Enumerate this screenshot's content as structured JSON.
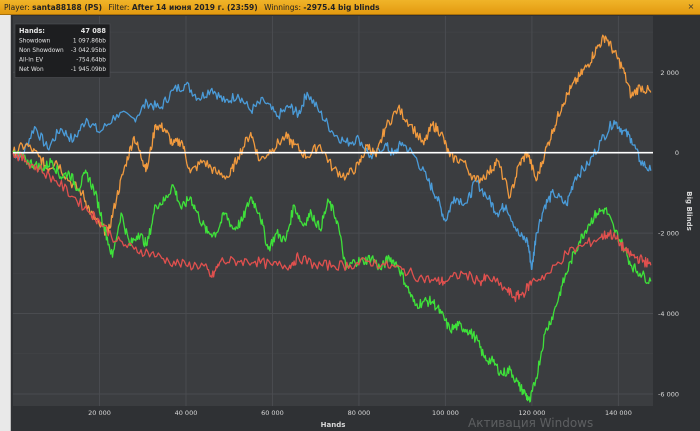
{
  "header": {
    "player_label": "Player:",
    "player_value": "santa88188 (PS)",
    "filter_label": "Filter:",
    "filter_value": "After 14 июня 2019 г. (23:59)",
    "winnings_label": "Winnings:",
    "winnings_value": "-2975.4 big blinds",
    "close_glyph": "×"
  },
  "stats": {
    "rows": [
      {
        "label": "Hands:",
        "value": "47 088"
      },
      {
        "label": "Showdown",
        "value": "1 097.86bb"
      },
      {
        "label": "Non Showdown",
        "value": "-3 042.95bb"
      },
      {
        "label": "All-In EV",
        "value": "-754.64bb"
      },
      {
        "label": "Net Won",
        "value": "-1 945.09bb"
      }
    ]
  },
  "watermark": "Активация Windows",
  "chart_data": {
    "type": "line",
    "xlabel": "Hands",
    "ylabel": "Big Blinds",
    "xlim": [
      0,
      148000
    ],
    "ylim": [
      -6300,
      3400
    ],
    "x_ticks": [
      20000,
      40000,
      60000,
      80000,
      100000,
      120000,
      140000
    ],
    "x_tick_labels": [
      "20 000",
      "40 000",
      "60 000",
      "80 000",
      "100 000",
      "120 000",
      "140 000"
    ],
    "y_ticks": [
      2000,
      0,
      -2000,
      -4000,
      -6000
    ],
    "y_tick_labels": [
      "2 000",
      "0",
      "-2 000",
      "-4 000",
      "-6 000"
    ],
    "y_axis_side": "right",
    "grid": true,
    "zero_line": true,
    "colors": {
      "blue": "#4a9bd8",
      "orange": "#f19a3e",
      "green": "#3ee03a",
      "red": "#e0504e",
      "zero": "#ffffff",
      "background": "#3b3d40",
      "grid": "#4a4c50",
      "text": "#d8d8d8"
    },
    "series": [
      {
        "color": "blue",
        "points": [
          [
            0,
            0
          ],
          [
            2000,
            -100
          ],
          [
            5000,
            650
          ],
          [
            8000,
            100
          ],
          [
            11000,
            600
          ],
          [
            14000,
            300
          ],
          [
            17000,
            850
          ],
          [
            20000,
            500
          ],
          [
            24000,
            950
          ],
          [
            28000,
            850
          ],
          [
            31000,
            1250
          ],
          [
            34000,
            1100
          ],
          [
            37000,
            1550
          ],
          [
            40000,
            1700
          ],
          [
            43000,
            1350
          ],
          [
            46000,
            1600
          ],
          [
            49000,
            1250
          ],
          [
            52000,
            1450
          ],
          [
            55000,
            1050
          ],
          [
            58000,
            1300
          ],
          [
            61000,
            900
          ],
          [
            64000,
            1150
          ],
          [
            66000,
            950
          ],
          [
            68000,
            1500
          ],
          [
            71000,
            1000
          ],
          [
            74000,
            500
          ],
          [
            77000,
            250
          ],
          [
            80000,
            350
          ],
          [
            83000,
            -150
          ],
          [
            86000,
            200
          ],
          [
            88000,
            -50
          ],
          [
            90000,
            250
          ],
          [
            93000,
            -100
          ],
          [
            96000,
            -700
          ],
          [
            98000,
            -1100
          ],
          [
            100000,
            -1700
          ],
          [
            102000,
            -1100
          ],
          [
            105000,
            -1250
          ],
          [
            107000,
            -700
          ],
          [
            110000,
            -1150
          ],
          [
            112000,
            -1500
          ],
          [
            114000,
            -1300
          ],
          [
            117000,
            -2050
          ],
          [
            119000,
            -2200
          ],
          [
            120000,
            -2900
          ],
          [
            121000,
            -2000
          ],
          [
            123000,
            -1300
          ],
          [
            125000,
            -1000
          ],
          [
            128000,
            -1300
          ],
          [
            130000,
            -600
          ],
          [
            133000,
            -300
          ],
          [
            136000,
            300
          ],
          [
            139000,
            800
          ],
          [
            141000,
            550
          ],
          [
            143000,
            350
          ],
          [
            145000,
            -200
          ],
          [
            147500,
            -450
          ]
        ]
      },
      {
        "color": "orange",
        "points": [
          [
            0,
            0
          ],
          [
            3000,
            200
          ],
          [
            6000,
            -100
          ],
          [
            8000,
            -400
          ],
          [
            10000,
            -200
          ],
          [
            13000,
            -700
          ],
          [
            16000,
            -1000
          ],
          [
            18000,
            -1500
          ],
          [
            20000,
            -1800
          ],
          [
            22000,
            -2000
          ],
          [
            24000,
            -1100
          ],
          [
            26000,
            -300
          ],
          [
            28000,
            400
          ],
          [
            30000,
            -200
          ],
          [
            31000,
            -400
          ],
          [
            33000,
            700
          ],
          [
            35000,
            600
          ],
          [
            37000,
            200
          ],
          [
            39000,
            300
          ],
          [
            41000,
            -500
          ],
          [
            44000,
            -200
          ],
          [
            47000,
            -500
          ],
          [
            50000,
            -600
          ],
          [
            52000,
            -100
          ],
          [
            55000,
            500
          ],
          [
            57000,
            -200
          ],
          [
            60000,
            100
          ],
          [
            63000,
            400
          ],
          [
            65000,
            200
          ],
          [
            68000,
            -100
          ],
          [
            71000,
            200
          ],
          [
            74000,
            -400
          ],
          [
            77000,
            -600
          ],
          [
            80000,
            -300
          ],
          [
            82000,
            200
          ],
          [
            84000,
            -100
          ],
          [
            86000,
            600
          ],
          [
            89000,
            1100
          ],
          [
            92000,
            700
          ],
          [
            95000,
            200
          ],
          [
            97000,
            700
          ],
          [
            99000,
            500
          ],
          [
            101000,
            -100
          ],
          [
            104000,
            -200
          ],
          [
            107000,
            -700
          ],
          [
            110000,
            -500
          ],
          [
            112000,
            -200
          ],
          [
            115000,
            -1100
          ],
          [
            117000,
            -300
          ],
          [
            119000,
            0
          ],
          [
            121000,
            -700
          ],
          [
            123000,
            0
          ],
          [
            125000,
            600
          ],
          [
            127000,
            1200
          ],
          [
            129000,
            1600
          ],
          [
            131000,
            1900
          ],
          [
            133000,
            2200
          ],
          [
            135000,
            2600
          ],
          [
            137000,
            2900
          ],
          [
            139000,
            2500
          ],
          [
            141000,
            2100
          ],
          [
            143000,
            1400
          ],
          [
            145000,
            1650
          ],
          [
            147500,
            1500
          ]
        ]
      },
      {
        "color": "green",
        "points": [
          [
            0,
            0
          ],
          [
            3000,
            -200
          ],
          [
            5000,
            -300
          ],
          [
            7000,
            -400
          ],
          [
            9000,
            -200
          ],
          [
            11000,
            -600
          ],
          [
            13000,
            -500
          ],
          [
            15000,
            -900
          ],
          [
            17000,
            -500
          ],
          [
            19000,
            -1000
          ],
          [
            21000,
            -1800
          ],
          [
            23000,
            -2600
          ],
          [
            25000,
            -1500
          ],
          [
            27000,
            -2300
          ],
          [
            29000,
            -2000
          ],
          [
            31000,
            -2300
          ],
          [
            33000,
            -1300
          ],
          [
            35000,
            -1200
          ],
          [
            37000,
            -800
          ],
          [
            39000,
            -1400
          ],
          [
            41000,
            -1100
          ],
          [
            43000,
            -1600
          ],
          [
            45000,
            -2000
          ],
          [
            47000,
            -2000
          ],
          [
            49000,
            -1500
          ],
          [
            51000,
            -1900
          ],
          [
            53000,
            -1700
          ],
          [
            55000,
            -1100
          ],
          [
            57000,
            -1500
          ],
          [
            59000,
            -2400
          ],
          [
            61000,
            -2000
          ],
          [
            63000,
            -2200
          ],
          [
            65000,
            -1300
          ],
          [
            67000,
            -1800
          ],
          [
            69000,
            -1500
          ],
          [
            71000,
            -1900
          ],
          [
            73000,
            -1200
          ],
          [
            75000,
            -1700
          ],
          [
            77000,
            -2900
          ],
          [
            79000,
            -2700
          ],
          [
            81000,
            -2700
          ],
          [
            83000,
            -2600
          ],
          [
            85000,
            -2900
          ],
          [
            87000,
            -2600
          ],
          [
            89000,
            -2800
          ],
          [
            91000,
            -3300
          ],
          [
            93000,
            -3800
          ],
          [
            95000,
            -3700
          ],
          [
            97000,
            -3700
          ],
          [
            99000,
            -4000
          ],
          [
            101000,
            -4400
          ],
          [
            103000,
            -4300
          ],
          [
            105000,
            -4400
          ],
          [
            107000,
            -4600
          ],
          [
            109000,
            -5100
          ],
          [
            111000,
            -5200
          ],
          [
            113000,
            -5500
          ],
          [
            115000,
            -5400
          ],
          [
            117000,
            -5800
          ],
          [
            118500,
            -6000
          ],
          [
            119500,
            -6200
          ],
          [
            121000,
            -5600
          ],
          [
            123000,
            -4500
          ],
          [
            125000,
            -4000
          ],
          [
            127000,
            -3300
          ],
          [
            129000,
            -2700
          ],
          [
            131000,
            -2200
          ],
          [
            133000,
            -1800
          ],
          [
            135000,
            -1500
          ],
          [
            137000,
            -1400
          ],
          [
            139000,
            -1900
          ],
          [
            141000,
            -2300
          ],
          [
            143000,
            -2800
          ],
          [
            145000,
            -3000
          ],
          [
            147500,
            -3200
          ]
        ]
      },
      {
        "color": "red",
        "points": [
          [
            0,
            0
          ],
          [
            3000,
            -200
          ],
          [
            6000,
            -400
          ],
          [
            10000,
            -700
          ],
          [
            14000,
            -1100
          ],
          [
            18000,
            -1500
          ],
          [
            20000,
            -1700
          ],
          [
            24000,
            -2200
          ],
          [
            28000,
            -2400
          ],
          [
            32000,
            -2500
          ],
          [
            36000,
            -2700
          ],
          [
            40000,
            -2800
          ],
          [
            44000,
            -2800
          ],
          [
            46000,
            -3100
          ],
          [
            48000,
            -2700
          ],
          [
            52000,
            -2700
          ],
          [
            56000,
            -2700
          ],
          [
            60000,
            -2800
          ],
          [
            64000,
            -2800
          ],
          [
            66000,
            -2600
          ],
          [
            70000,
            -2800
          ],
          [
            74000,
            -2800
          ],
          [
            78000,
            -2800
          ],
          [
            82000,
            -2700
          ],
          [
            86000,
            -2800
          ],
          [
            90000,
            -2900
          ],
          [
            94000,
            -3100
          ],
          [
            98000,
            -3200
          ],
          [
            100000,
            -3200
          ],
          [
            104000,
            -3000
          ],
          [
            108000,
            -3200
          ],
          [
            110000,
            -3100
          ],
          [
            114000,
            -3400
          ],
          [
            116000,
            -3600
          ],
          [
            118000,
            -3500
          ],
          [
            120000,
            -3200
          ],
          [
            124000,
            -3000
          ],
          [
            128000,
            -2500
          ],
          [
            132000,
            -2300
          ],
          [
            136000,
            -2100
          ],
          [
            138000,
            -2000
          ],
          [
            140000,
            -2200
          ],
          [
            142000,
            -2500
          ],
          [
            144000,
            -2600
          ],
          [
            146000,
            -2700
          ],
          [
            147500,
            -2800
          ]
        ]
      }
    ]
  }
}
